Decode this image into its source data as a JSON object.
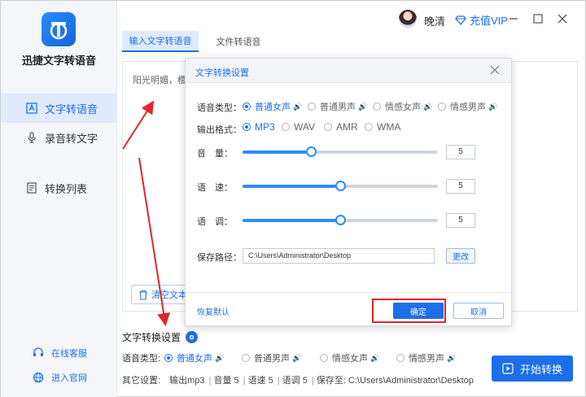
{
  "app": {
    "name": "迅捷文字转语音"
  },
  "sidebar": {
    "items": [
      {
        "label": "文字转语音",
        "icon": "text-to-speech-icon",
        "active": true
      },
      {
        "label": "录音转文字",
        "icon": "microphone-icon",
        "active": false
      },
      {
        "label": "转换列表",
        "icon": "list-icon",
        "active": false
      }
    ],
    "links": [
      {
        "label": "在线客服",
        "icon": "support-icon"
      },
      {
        "label": "进入官网",
        "icon": "globe-icon"
      }
    ]
  },
  "topbar": {
    "username": "晚清",
    "vip_label": "充值VIP"
  },
  "tabs": [
    {
      "label": "输入文字转语音",
      "active": true
    },
    {
      "label": "文件转语音",
      "active": false
    }
  ],
  "editor": {
    "text_preview": "阳光明媚，樱花",
    "clear_label": "清空文本"
  },
  "dialog": {
    "title": "文字转换设置",
    "voice_label": "语音类型：",
    "voice_options": [
      {
        "label": "普通女声",
        "selected": true
      },
      {
        "label": "普通男声",
        "selected": false
      },
      {
        "label": "情感女声",
        "selected": false
      },
      {
        "label": "情感男声",
        "selected": false
      }
    ],
    "format_label": "输出格式：",
    "format_options": [
      {
        "label": "MP3",
        "selected": true
      },
      {
        "label": "WAV",
        "selected": false
      },
      {
        "label": "AMR",
        "selected": false
      },
      {
        "label": "WMA",
        "selected": false
      }
    ],
    "volume_label": "音　量：",
    "speed_label": "语　速：",
    "pitch_label": "语　调：",
    "volume": {
      "value": "5",
      "fraction": 0.35
    },
    "speed": {
      "value": "5",
      "fraction": 0.5
    },
    "pitch": {
      "value": "5",
      "fraction": 0.5
    },
    "save_path_label": "保存路径：",
    "save_path": "C:\\Users\\Administrator\\Desktop",
    "change_label": "更改",
    "restore_label": "恢复默认",
    "ok_label": "确定",
    "cancel_label": "取消"
  },
  "bottom": {
    "settings_title": "文字转换设置",
    "voice_label": "语音类型:",
    "voice_options": [
      {
        "label": "普通女声",
        "selected": true
      },
      {
        "label": "普通男声",
        "selected": false
      },
      {
        "label": "情感女声",
        "selected": false
      },
      {
        "label": "情感男声",
        "selected": false
      }
    ],
    "other_label": "其它设置:",
    "other_items": [
      "输出mp3",
      "音量 5",
      "语速 5",
      "语调 5",
      "保存至: C:\\Users\\Administrator\\Desktop"
    ],
    "start_label": "开始转换"
  },
  "colors": {
    "accent": "#1c6fe8",
    "highlight": "#e0262b"
  }
}
